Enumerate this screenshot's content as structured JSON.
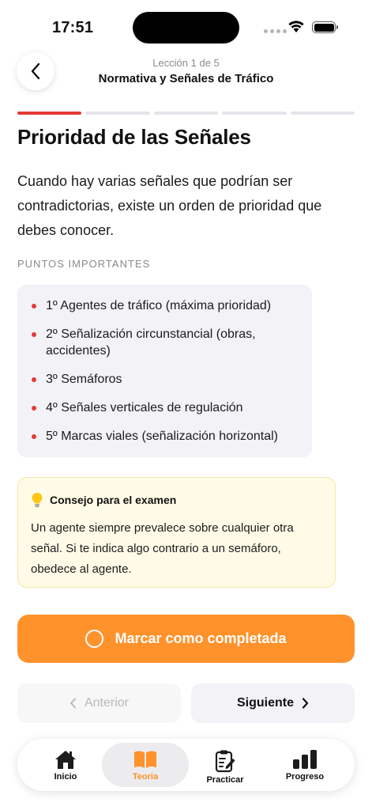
{
  "status": {
    "time": "17:51"
  },
  "header": {
    "lesson_counter": "Lección 1 de 5",
    "lesson_title": "Normativa y Señales de Tráfico"
  },
  "progress": {
    "total_segments": 5,
    "current_segment": 1,
    "active_color": "#e53935"
  },
  "content": {
    "title": "Prioridad de las Señales",
    "intro": "Cuando hay varias señales que podrían ser contradictorias, existe un orden de prioridad que debes conocer.",
    "section_label": "PUNTOS IMPORTANTES",
    "points": [
      "1º Agentes de tráfico (máxima prioridad)",
      "2º Señalización circunstancial (obras, accidentes)",
      "3º Semáforos",
      "4º Señales verticales de regulación",
      "5º Marcas viales (señalización horizontal)"
    ]
  },
  "tip": {
    "icon": "lightbulb-icon",
    "title": "Consejo para el examen",
    "body": "Un agente siempre prevalece sobre cualquier otra señal. Si te indica algo contrario a un semáforo, obedece al agente."
  },
  "actions": {
    "complete_label": "Marcar como completada",
    "previous_label": "Anterior",
    "next_label": "Siguiente",
    "accent_color": "#ff922b"
  },
  "tabs": [
    {
      "label": "Inicio",
      "icon": "house-icon",
      "active": false
    },
    {
      "label": "Teoria",
      "icon": "book-icon",
      "active": true
    },
    {
      "label": "Practicar",
      "icon": "clipboard-icon",
      "active": false
    },
    {
      "label": "Progreso",
      "icon": "bar-chart-icon",
      "active": false
    }
  ]
}
